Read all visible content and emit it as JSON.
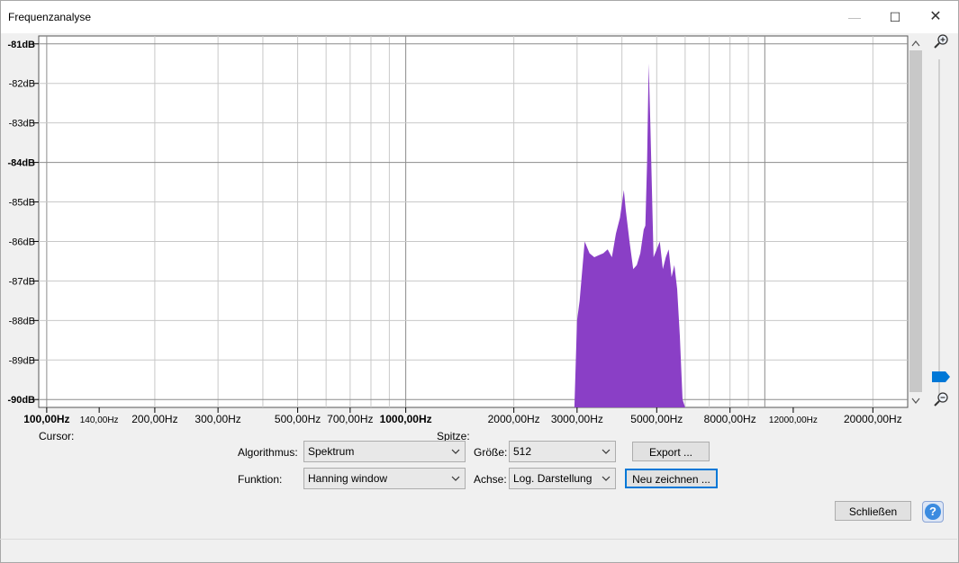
{
  "window": {
    "title": "Frequenzanalyse",
    "min_icon": "—",
    "max_icon": "☐",
    "close_icon": "✕"
  },
  "colors": {
    "spectrum": "#8a3fc6",
    "grid": "#c8c8c8",
    "plot_bg": "#ffffff"
  },
  "chart_data": {
    "type": "area",
    "x_scale": "log",
    "y_unit": "dB",
    "xlim": [
      95,
      25000
    ],
    "ylim": [
      -90.2,
      -80.8
    ],
    "y_ticks": [
      "-81dB",
      "-82dB",
      "-83dB",
      "-84dB",
      "-85dB",
      "-86dB",
      "-87dB",
      "-88dB",
      "-89dB",
      "-90dB"
    ],
    "y_tick_values": [
      -81,
      -82,
      -83,
      -84,
      -85,
      -86,
      -87,
      -88,
      -89,
      -90
    ],
    "bold_y_ticks": [
      -81,
      -84,
      -90
    ],
    "x_ticks": [
      {
        "value": 100,
        "label": "100,00Hz",
        "bold": true,
        "small": false
      },
      {
        "value": 140,
        "label": "140,00Hz",
        "bold": false,
        "small": true
      },
      {
        "value": 200,
        "label": "200,00Hz",
        "bold": false,
        "small": false
      },
      {
        "value": 300,
        "label": "300,00Hz",
        "bold": false,
        "small": false
      },
      {
        "value": 500,
        "label": "500,00Hz",
        "bold": false,
        "small": false
      },
      {
        "value": 700,
        "label": "700,00Hz",
        "bold": false,
        "small": false
      },
      {
        "value": 1000,
        "label": "1000,00Hz",
        "bold": true,
        "small": false
      },
      {
        "value": 2000,
        "label": "2000,00Hz",
        "bold": false,
        "small": false
      },
      {
        "value": 3000,
        "label": "3000,00Hz",
        "bold": false,
        "small": false
      },
      {
        "value": 5000,
        "label": "5000,00Hz",
        "bold": false,
        "small": false
      },
      {
        "value": 8000,
        "label": "8000,00Hz",
        "bold": false,
        "small": false
      },
      {
        "value": 12000,
        "label": "12000,00Hz",
        "bold": false,
        "small": true
      },
      {
        "value": 20000,
        "label": "20000,00Hz",
        "bold": false,
        "small": false
      }
    ],
    "x_grid": [
      100,
      200,
      300,
      400,
      500,
      600,
      700,
      800,
      900,
      1000,
      2000,
      3000,
      4000,
      5000,
      6000,
      7000,
      8000,
      9000,
      10000,
      20000
    ],
    "series": [
      {
        "x": [
          2950,
          3000,
          3050,
          3150,
          3250,
          3350,
          3450,
          3550,
          3650,
          3750,
          3850,
          3950,
          4050,
          4100,
          4200,
          4300,
          4400,
          4500,
          4600,
          4650,
          4700,
          4750,
          4800,
          4900,
          5000,
          5100,
          5200,
          5300,
          5400,
          5500,
          5600,
          5700,
          5800,
          5900,
          6000,
          6100,
          6200,
          6300,
          6400
        ],
        "y": [
          -90.5,
          -88,
          -87.5,
          -86,
          -86.3,
          -86.4,
          -86.35,
          -86.3,
          -86.2,
          -86.4,
          -85.8,
          -85.4,
          -84.7,
          -85.2,
          -86.0,
          -86.7,
          -86.6,
          -86.3,
          -85.7,
          -85.6,
          -84.0,
          -81.5,
          -83.0,
          -86.4,
          -86.2,
          -86.0,
          -86.7,
          -86.4,
          -86.2,
          -86.9,
          -86.6,
          -87.2,
          -88.4,
          -90.0,
          -90.5,
          -90.5,
          -90.5,
          -90.5,
          -90.5
        ]
      }
    ]
  },
  "readouts": {
    "cursor_label": "Cursor:",
    "peak_label": "Spitze:"
  },
  "controls": {
    "algorithm_label": "Algorithmus:",
    "algorithm_value": "Spektrum",
    "size_label": "Größe:",
    "size_value": "512",
    "export_button": "Export ...",
    "function_label": "Funktion:",
    "function_value": "Hanning window",
    "axis_label": "Achse:",
    "axis_value": "Log. Darstellung",
    "redraw_button": "Neu zeichnen ...",
    "close_button": "Schließen",
    "help_icon": "?"
  }
}
